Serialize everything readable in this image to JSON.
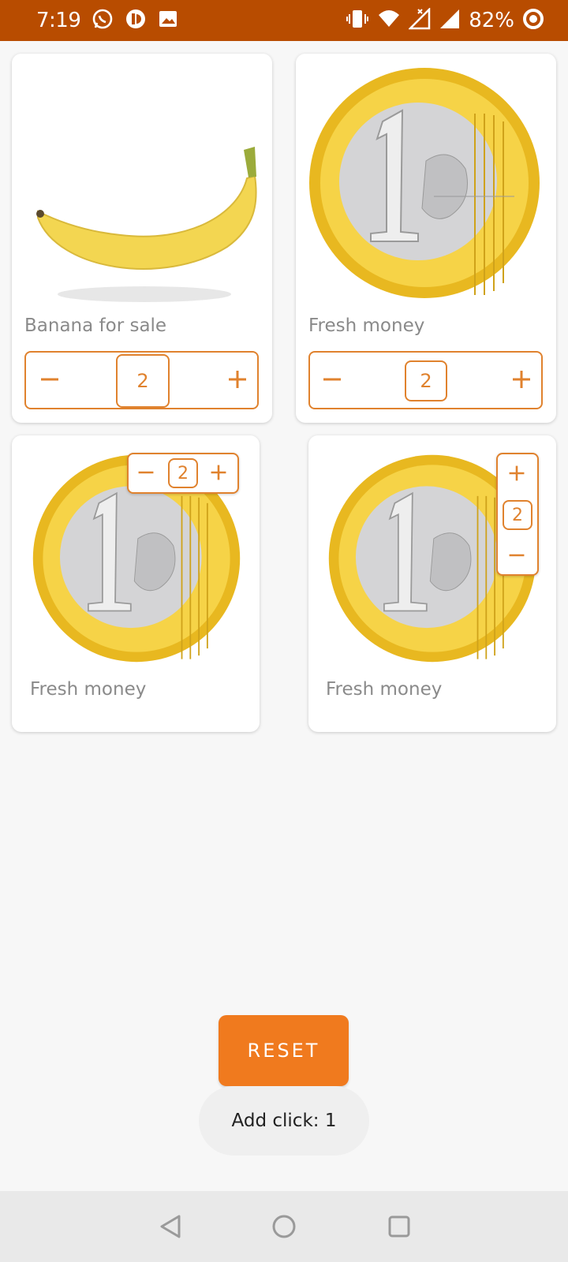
{
  "status_bar": {
    "time": "7:19",
    "battery": "82%",
    "icons": [
      "whatsapp-icon",
      "app-notification-icon",
      "gallery-icon",
      "vibrate-icon",
      "wifi-icon",
      "signal-icon",
      "signal-icon",
      "battery-ring-icon"
    ]
  },
  "colors": {
    "status_bar": "#b84c00",
    "accent": "#e0822e",
    "reset_button": "#f07a1e"
  },
  "products": [
    {
      "label": "Banana for sale",
      "quantity": "2",
      "image": "banana-image",
      "stepper": "horizontal"
    },
    {
      "label": "Fresh money",
      "quantity": "2",
      "image": "euro-coin-image",
      "stepper": "horizontal"
    },
    {
      "label": "Fresh money",
      "quantity": "2",
      "image": "euro-coin-image",
      "stepper": "horizontal-compact"
    },
    {
      "label": "Fresh money",
      "quantity": "2",
      "image": "euro-coin-image",
      "stepper": "vertical"
    }
  ],
  "reset_label": "RESET",
  "toast_text": "Add click: 1",
  "nav": [
    "back-icon",
    "home-icon",
    "recents-icon"
  ]
}
